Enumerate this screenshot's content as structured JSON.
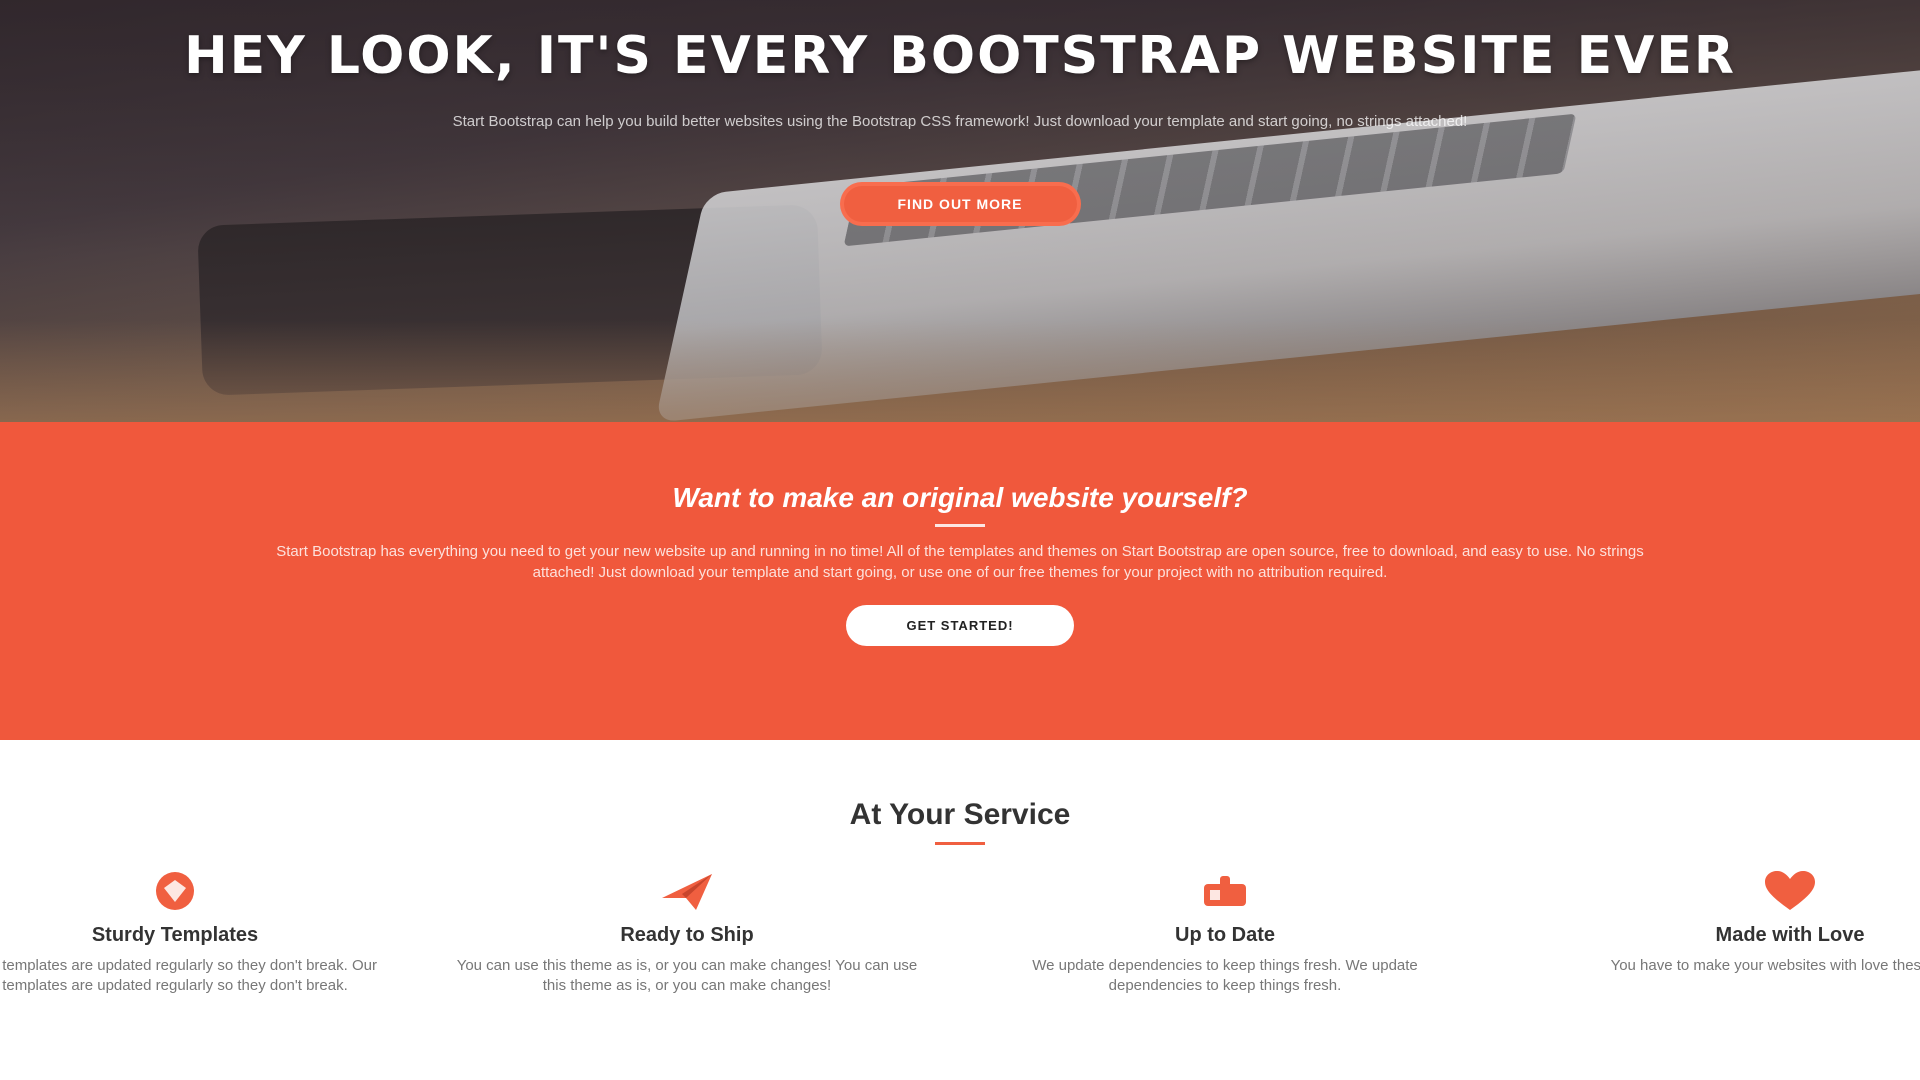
{
  "hero": {
    "title": "HEY LOOK, IT'S EVERY BOOTSTRAP WEBSITE EVER",
    "subtitle": "Start Bootstrap can help you build better websites using the Bootstrap CSS framework! Just download your template and start going, no strings attached!",
    "button_label": "Find Out More"
  },
  "about": {
    "heading": "Want to make an original website yourself?",
    "text": "Start Bootstrap has everything you need to get your new website up and running in no time! All of the templates and themes on Start Bootstrap are open source, free to download, and easy to use. No strings attached! Just download your template and start going, or use one of our free themes for your project with no attribution required.",
    "button_label": "Get Started!"
  },
  "services": {
    "heading": "At Your Service",
    "items": [
      {
        "icon": "diamond-icon",
        "title": "Sturdy Templates",
        "text": "Our templates are updated regularly so they don't break. Our templates are updated regularly so they don't break."
      },
      {
        "icon": "paper-plane-icon",
        "title": "Ready to Ship",
        "text": "You can use this theme as is, or you can make changes! You can use this theme as is, or you can make changes!"
      },
      {
        "icon": "newspaper-icon",
        "title": "Up to Date",
        "text": "We update dependencies to keep things fresh. We update dependencies to keep things fresh."
      },
      {
        "icon": "heart-icon",
        "title": "Made with Love",
        "text": "You have to make your websites with love these days!"
      }
    ]
  },
  "colors": {
    "accent": "#f05f40",
    "section_orange": "#f0583c",
    "hero_dark": "#3c3338"
  }
}
